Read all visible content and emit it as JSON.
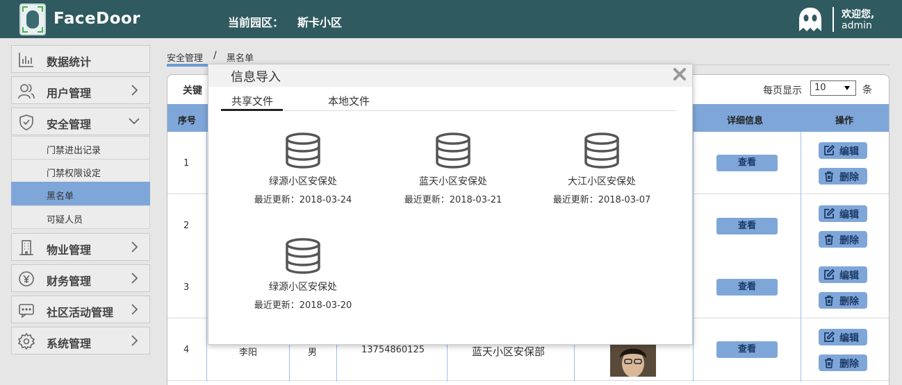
{
  "header": {
    "app_name": "FaceDoor",
    "park_label": "当前园区：",
    "park_name": "斯卡小区",
    "welcome": "欢迎您,",
    "username": "admin"
  },
  "sidebar": {
    "items": [
      {
        "label": "数据统计",
        "icon": "bar-chart-icon"
      },
      {
        "label": "用户管理",
        "icon": "users-icon"
      },
      {
        "label": "安全管理",
        "icon": "shield-icon"
      },
      {
        "label": "物业管理",
        "icon": "building-icon"
      },
      {
        "label": "财务管理",
        "icon": "money-icon"
      },
      {
        "label": "社区活动管理",
        "icon": "chat-icon"
      },
      {
        "label": "系统管理",
        "icon": "gear-icon"
      }
    ],
    "sub_items": [
      "门禁进出记录",
      "门禁权限设定",
      "黑名单",
      "可疑人员"
    ],
    "active_sub": "黑名单"
  },
  "breadcrumb": {
    "section": "安全管理",
    "separator": "/",
    "page": "黑名单"
  },
  "toolbar": {
    "keyword_label": "关键",
    "per_page_label": "每页显示",
    "per_page_value": "10",
    "per_page_unit": "条"
  },
  "table": {
    "headers": {
      "index": "序号",
      "details": "详细信息",
      "actions": "操作"
    },
    "rows": [
      {
        "index": "1"
      },
      {
        "index": "2"
      },
      {
        "index": "3"
      },
      {
        "index": "4",
        "name": "李阳",
        "gender": "男",
        "phone": "13754860125",
        "dept": "蓝天小区安保部"
      }
    ],
    "view_label": "查看",
    "edit_label": "编辑",
    "delete_label": "删除"
  },
  "modal": {
    "title": "信息导入",
    "tabs": [
      "共享文件",
      "本地文件"
    ],
    "active_tab": "共享文件",
    "files": [
      {
        "name": "绿源小区安保处",
        "updated": "最近更新：2018-03-24"
      },
      {
        "name": "蓝天小区安保处",
        "updated": "最近更新：2018-03-21"
      },
      {
        "name": "大江小区安保处",
        "updated": "最近更新：2018-03-07"
      },
      {
        "name": "绿源小区安保处",
        "updated": "最近更新：2018-03-20"
      }
    ]
  },
  "colors": {
    "header_bg": "#2f5a5f",
    "accent": "#7fa6d8",
    "active_nav": "#7fa6d8"
  }
}
